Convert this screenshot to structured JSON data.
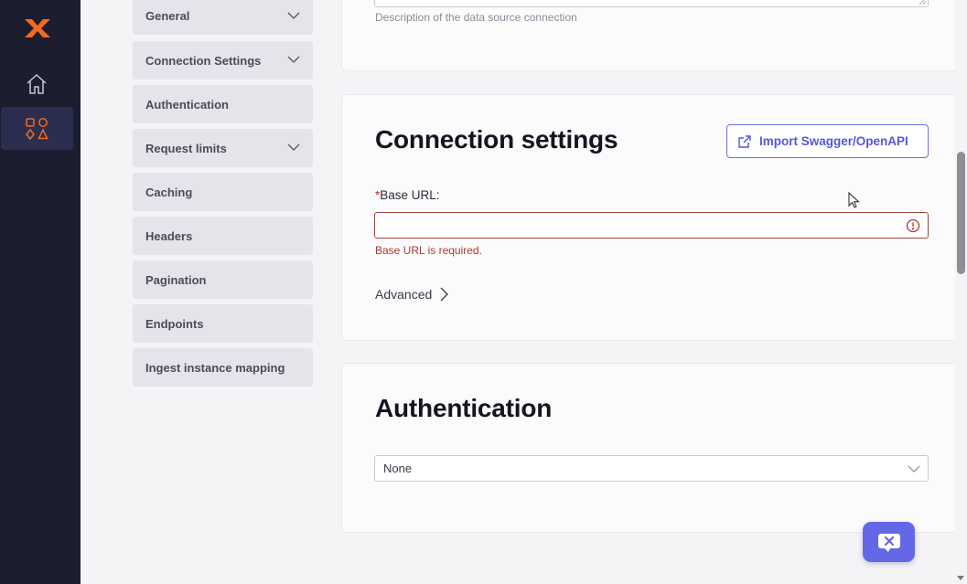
{
  "rail": {
    "logo": "x-logo",
    "items": [
      {
        "icon": "home-icon",
        "active": false
      },
      {
        "icon": "apps-icon",
        "active": true
      }
    ]
  },
  "sections_nav": {
    "items": [
      {
        "label": "General",
        "expandable": true
      },
      {
        "label": "Connection Settings",
        "expandable": true
      },
      {
        "label": "Authentication",
        "expandable": false
      },
      {
        "label": "Request limits",
        "expandable": true
      },
      {
        "label": "Caching",
        "expandable": false
      },
      {
        "label": "Headers",
        "expandable": false
      },
      {
        "label": "Pagination",
        "expandable": false
      },
      {
        "label": "Endpoints",
        "expandable": false
      },
      {
        "label": "Ingest instance mapping",
        "expandable": false
      }
    ]
  },
  "general": {
    "description_helper": "Description of the data source connection"
  },
  "connection": {
    "title": "Connection settings",
    "import_button": "Import Swagger/OpenAPI",
    "base_url_required_mark": "*",
    "base_url_label": "Base URL:",
    "base_url_value": "",
    "base_url_error": "Base URL is required.",
    "advanced_label": "Advanced"
  },
  "authentication": {
    "title": "Authentication",
    "selected": "None"
  },
  "colors": {
    "rail_bg": "#1c1d2e",
    "accent": "#5457d8",
    "error": "#a83a30",
    "brand_orange": "#f26a21"
  }
}
